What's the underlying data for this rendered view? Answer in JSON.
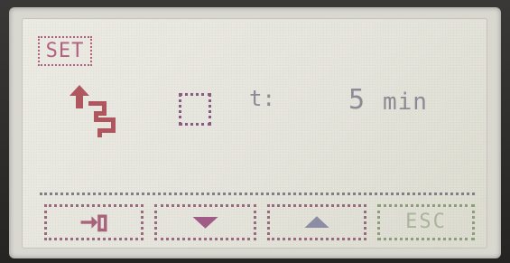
{
  "screen": {
    "mode_label": "SET",
    "time": {
      "label": "t:",
      "value": "5",
      "unit": "min"
    }
  },
  "softkeys": {
    "esc_label": "ESC"
  },
  "icons": {
    "rate_icon": "flow-rate-up-icon",
    "checkbox": "checkbox-empty",
    "enter": "enter-icon",
    "down": "triangle-down-icon",
    "up": "triangle-up-icon"
  },
  "colors": {
    "lcd_background": "#e7e6de",
    "set_border": "#b06080",
    "time_text": "#8d8a96",
    "divider": "#7f7f88",
    "esc_border": "#8aa078"
  }
}
